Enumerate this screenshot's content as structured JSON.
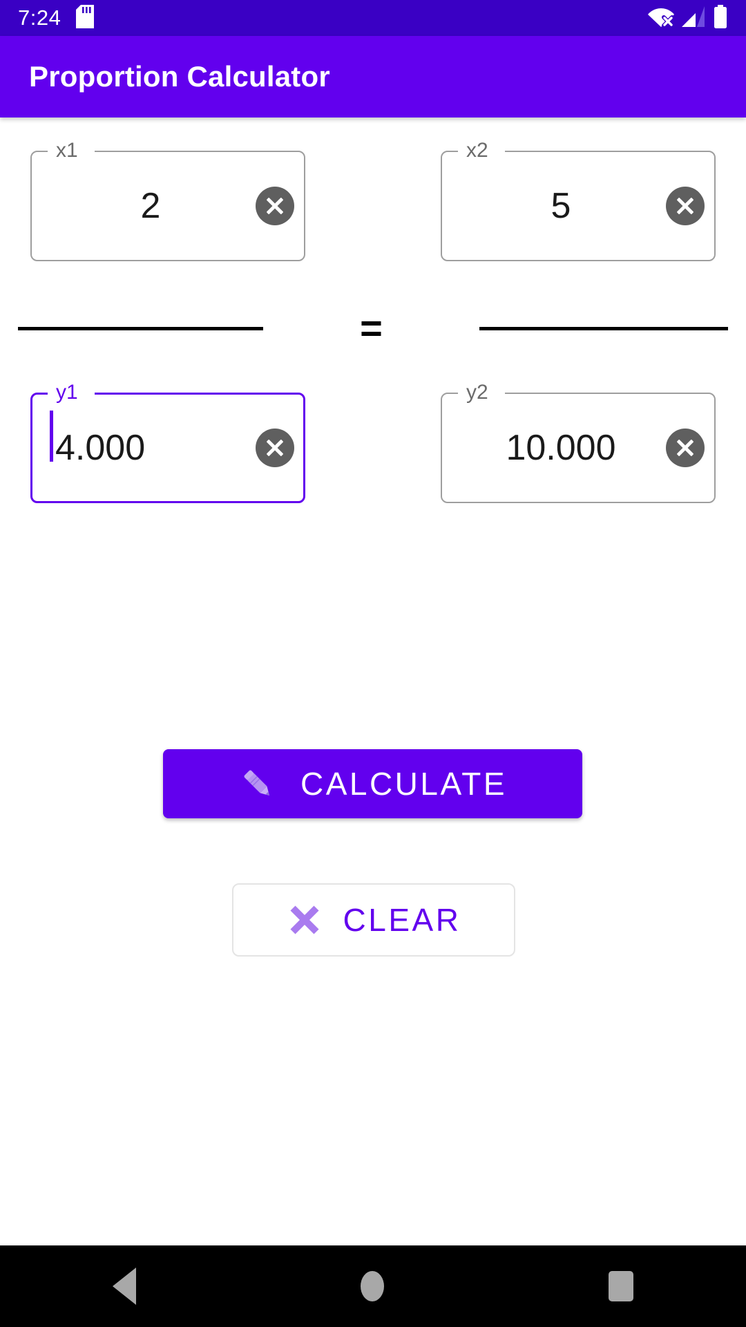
{
  "status_bar": {
    "clock": "7:24",
    "icons": {
      "sd_card": "sd-card-icon",
      "wifi_off": "wifi-off-icon",
      "cellular": "cellular-signal-icon",
      "battery": "battery-icon"
    },
    "background": "#3A00C4"
  },
  "app_bar": {
    "title": "Proportion Calculator",
    "background": "#6200EE",
    "text_color": "#FFFFFF"
  },
  "theme": {
    "primary": "#6200EE",
    "on_primary": "#FFFFFF",
    "outline": "#9E9E9E",
    "clear_chip": "#5F5F5F"
  },
  "form": {
    "numerators": [
      {
        "label": "x1",
        "value": "2",
        "placeholder": "x1",
        "focused": false,
        "clear_icon": "clear-circle-icon"
      },
      {
        "label": "x2",
        "value": "5",
        "placeholder": "x2",
        "focused": false,
        "clear_icon": "clear-circle-icon"
      }
    ],
    "operator": "=",
    "denominators": [
      {
        "label": "y1",
        "value": "4.000",
        "placeholder": "y1",
        "focused": true,
        "clear_icon": "clear-circle-icon"
      },
      {
        "label": "y2",
        "value": "10.000",
        "placeholder": "y2",
        "focused": false,
        "clear_icon": "clear-circle-icon"
      }
    ]
  },
  "actions": {
    "calculate": {
      "label": "CALCULATE",
      "icon": "pencil-icon",
      "background": "#6200EE",
      "text_color": "#FFFFFF"
    },
    "clear": {
      "label": "CLEAR",
      "icon": "x-mark-icon",
      "background": "#FFFFFF",
      "text_color": "#6200EE"
    }
  },
  "nav_bar": {
    "back": "back-triangle-icon",
    "home": "home-circle-icon",
    "recents": "recents-square-icon"
  }
}
